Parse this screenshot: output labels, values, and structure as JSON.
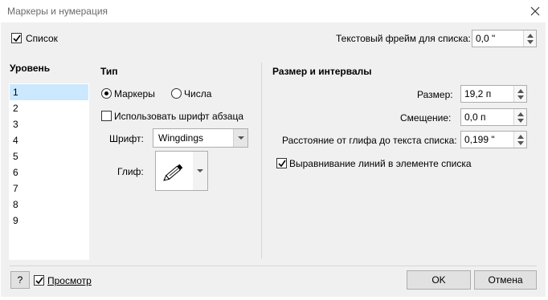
{
  "window": {
    "title": "Маркеры и нумерация"
  },
  "top": {
    "list_label": "Список",
    "list_checked": true,
    "text_frame_label": "Текстовый фрейм для списка:",
    "text_frame_value": "0,0 \""
  },
  "levels": {
    "header": "Уровень",
    "items": [
      "1",
      "2",
      "3",
      "4",
      "5",
      "6",
      "7",
      "8",
      "9"
    ],
    "selected": "1"
  },
  "type": {
    "header": "Тип",
    "markers_label": "Маркеры",
    "markers_selected": true,
    "numbers_label": "Числа",
    "use_paragraph_font_label": "Использовать шрифт абзаца",
    "use_paragraph_font_checked": false,
    "font_label": "Шрифт:",
    "font_value": "Wingdings",
    "glyph_label": "Глиф:",
    "glyph_icon": "pencil-icon"
  },
  "size": {
    "header": "Размер и интервалы",
    "size_label": "Размер:",
    "size_value": "19,2 п",
    "offset_label": "Смещение:",
    "offset_value": "0,0 п",
    "distance_label": "Расстояние от глифа до текста списка:",
    "distance_value": "0,199 \"",
    "align_label": "Выравнивание линий в элементе списка",
    "align_checked": true
  },
  "footer": {
    "help_label": "?",
    "preview_label": "Просмотр",
    "preview_checked": true,
    "ok_label": "OK",
    "cancel_label": "Отмена"
  }
}
